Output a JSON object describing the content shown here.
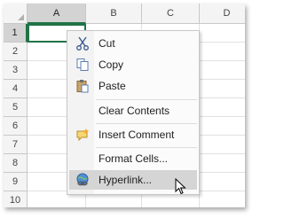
{
  "sheet": {
    "columns": [
      "A",
      "B",
      "C",
      "D"
    ],
    "rows": [
      "1",
      "2",
      "3",
      "4",
      "5",
      "6",
      "7",
      "8",
      "9",
      "10"
    ],
    "selected_column": "A",
    "selected_row": "1"
  },
  "context_menu": {
    "items": [
      {
        "label": "Cut",
        "icon": "scissors-icon"
      },
      {
        "label": "Copy",
        "icon": "copy-icon"
      },
      {
        "label": "Paste",
        "icon": "paste-icon"
      },
      {
        "label": "Clear Contents",
        "icon": ""
      },
      {
        "label": "Insert Comment",
        "icon": "insert-comment-icon"
      },
      {
        "label": "Format Cells...",
        "icon": ""
      },
      {
        "label": "Hyperlink...",
        "icon": "hyperlink-icon"
      }
    ],
    "hovered_item": "Hyperlink..."
  },
  "colors": {
    "accent": "#217346",
    "header_bg": "#f4f4f4",
    "header_selected_bg": "#d3d3d3",
    "menu_bg": "#fbfbfb",
    "menu_hover_bg": "#d5d5d5"
  }
}
